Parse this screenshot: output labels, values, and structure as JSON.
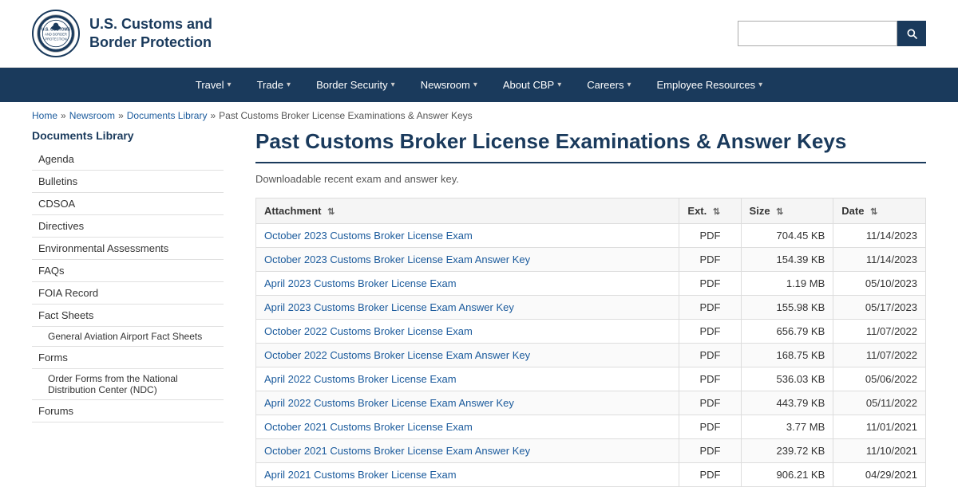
{
  "header": {
    "logo_alt": "U.S. Customs and Border Protection Seal",
    "agency_name": "U.S. Customs and\nBorder Protection",
    "search_placeholder": ""
  },
  "nav": {
    "items": [
      {
        "label": "Travel",
        "has_dropdown": true
      },
      {
        "label": "Trade",
        "has_dropdown": true
      },
      {
        "label": "Border Security",
        "has_dropdown": true
      },
      {
        "label": "Newsroom",
        "has_dropdown": true
      },
      {
        "label": "About CBP",
        "has_dropdown": true
      },
      {
        "label": "Careers",
        "has_dropdown": true
      },
      {
        "label": "Employee Resources",
        "has_dropdown": true
      }
    ]
  },
  "breadcrumb": {
    "items": [
      {
        "label": "Home",
        "href": "#"
      },
      {
        "label": "Newsroom",
        "href": "#"
      },
      {
        "label": "Documents Library",
        "href": "#"
      },
      {
        "label": "Past Customs Broker License Examinations & Answer Keys",
        "href": null
      }
    ]
  },
  "sidebar": {
    "title": "Documents Library",
    "items": [
      {
        "label": "Agenda",
        "level": 1
      },
      {
        "label": "Bulletins",
        "level": 1
      },
      {
        "label": "CDSOA",
        "level": 1
      },
      {
        "label": "Directives",
        "level": 1
      },
      {
        "label": "Environmental Assessments",
        "level": 1
      },
      {
        "label": "FAQs",
        "level": 1
      },
      {
        "label": "FOIA Record",
        "level": 1
      },
      {
        "label": "Fact Sheets",
        "level": 1
      },
      {
        "label": "General Aviation Airport Fact Sheets",
        "level": 2
      },
      {
        "label": "Forms",
        "level": 1
      },
      {
        "label": "Order Forms from the National Distribution Center (NDC)",
        "level": 2
      },
      {
        "label": "Forums",
        "level": 1
      }
    ]
  },
  "page": {
    "title": "Past Customs Broker License Examinations & Answer Keys",
    "subtitle": "Downloadable recent exam and answer key."
  },
  "table": {
    "headers": [
      {
        "label": "Attachment",
        "sortable": true,
        "key": "attachment"
      },
      {
        "label": "Ext.",
        "sortable": true,
        "key": "ext"
      },
      {
        "label": "Size",
        "sortable": true,
        "key": "size"
      },
      {
        "label": "Date",
        "sortable": true,
        "key": "date"
      }
    ],
    "rows": [
      {
        "attachment": "October 2023 Customs Broker License Exam",
        "ext": "PDF",
        "size": "704.45 KB",
        "date": "11/14/2023"
      },
      {
        "attachment": "October 2023 Customs Broker License Exam Answer Key",
        "ext": "PDF",
        "size": "154.39 KB",
        "date": "11/14/2023"
      },
      {
        "attachment": "April 2023 Customs Broker License Exam",
        "ext": "PDF",
        "size": "1.19 MB",
        "date": "05/10/2023"
      },
      {
        "attachment": "April 2023 Customs Broker License Exam Answer Key",
        "ext": "PDF",
        "size": "155.98 KB",
        "date": "05/17/2023"
      },
      {
        "attachment": "October 2022 Customs Broker License Exam",
        "ext": "PDF",
        "size": "656.79 KB",
        "date": "11/07/2022"
      },
      {
        "attachment": "October 2022 Customs Broker License Exam Answer Key",
        "ext": "PDF",
        "size": "168.75 KB",
        "date": "11/07/2022"
      },
      {
        "attachment": "April 2022 Customs Broker License Exam",
        "ext": "PDF",
        "size": "536.03 KB",
        "date": "05/06/2022"
      },
      {
        "attachment": "April 2022 Customs Broker License Exam Answer Key",
        "ext": "PDF",
        "size": "443.79 KB",
        "date": "05/11/2022"
      },
      {
        "attachment": "October 2021 Customs Broker License Exam",
        "ext": "PDF",
        "size": "3.77 MB",
        "date": "11/01/2021"
      },
      {
        "attachment": "October 2021 Customs Broker License Exam Answer Key",
        "ext": "PDF",
        "size": "239.72 KB",
        "date": "11/10/2021"
      },
      {
        "attachment": "April 2021 Customs Broker License Exam",
        "ext": "PDF",
        "size": "906.21 KB",
        "date": "04/29/2021"
      }
    ]
  }
}
